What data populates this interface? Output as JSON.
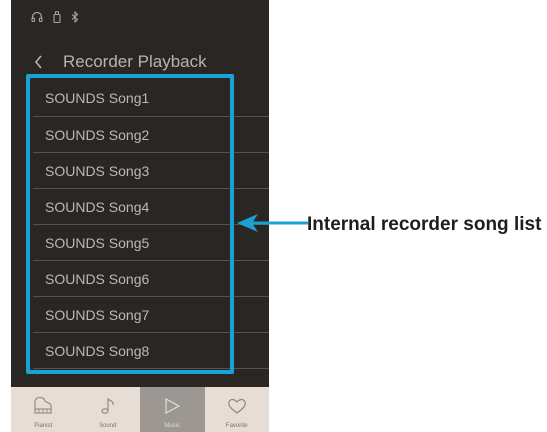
{
  "header": {
    "title": "Recorder Playback"
  },
  "songs": [
    "SOUNDS Song1",
    "SOUNDS Song2",
    "SOUNDS Song3",
    "SOUNDS Song4",
    "SOUNDS Song5",
    "SOUNDS Song6",
    "SOUNDS Song7",
    "SOUNDS Song8"
  ],
  "tabs": [
    {
      "label": "Pianist",
      "icon": "piano-icon"
    },
    {
      "label": "Sound",
      "icon": "music-note-icon"
    },
    {
      "label": "Music",
      "icon": "play-icon"
    },
    {
      "label": "Favorite",
      "icon": "heart-icon"
    }
  ],
  "annotation": {
    "text": "Internal recorder song list"
  },
  "colors": {
    "highlight": "#1aa2d6",
    "screen_bg": "#2a2624",
    "tab_bar": "#e7ddd4"
  }
}
